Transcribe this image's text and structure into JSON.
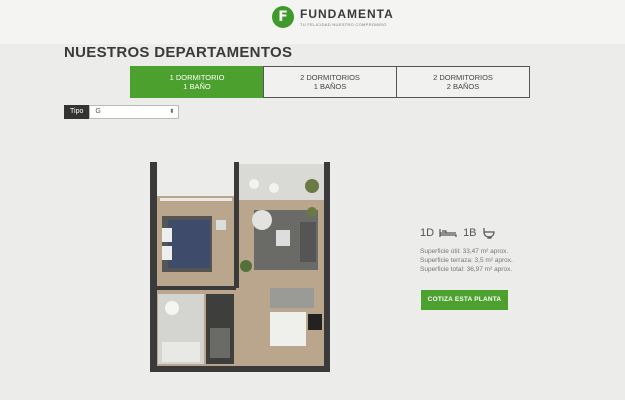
{
  "brand": {
    "name": "FUNDAMENTA",
    "logo_letter": "F",
    "tagline": "TU FELICIDAD NUESTRO COMPROMISO"
  },
  "page": {
    "title": "NUESTROS DEPARTAMENTOS"
  },
  "tabs": [
    {
      "line1": "1 DORMITORIO",
      "line2": "1 BAÑO",
      "active": true
    },
    {
      "line1": "2 DORMITORIOS",
      "line2": "1 BAÑOS",
      "active": false
    },
    {
      "line1": "2 DORMITORIOS",
      "line2": "2 BAÑOS",
      "active": false
    }
  ],
  "filter": {
    "label": "Tipo",
    "value": "G",
    "caret": "⬍"
  },
  "specs": {
    "dorm_label": "1D",
    "bath_label": "1B",
    "bed_icon": "bed-icon",
    "toilet_icon": "toilet-icon",
    "lines": [
      "Superficie útil: 33,47 m² aprox.",
      "Superficie terraza: 3,5 m² aprox.",
      "Superficie total: 36,97 m² aprox."
    ]
  },
  "cta": {
    "label": "COTIZA ESTA PLANTA"
  },
  "colors": {
    "accent": "#4ca12e",
    "wall": "#3a3a3a"
  }
}
